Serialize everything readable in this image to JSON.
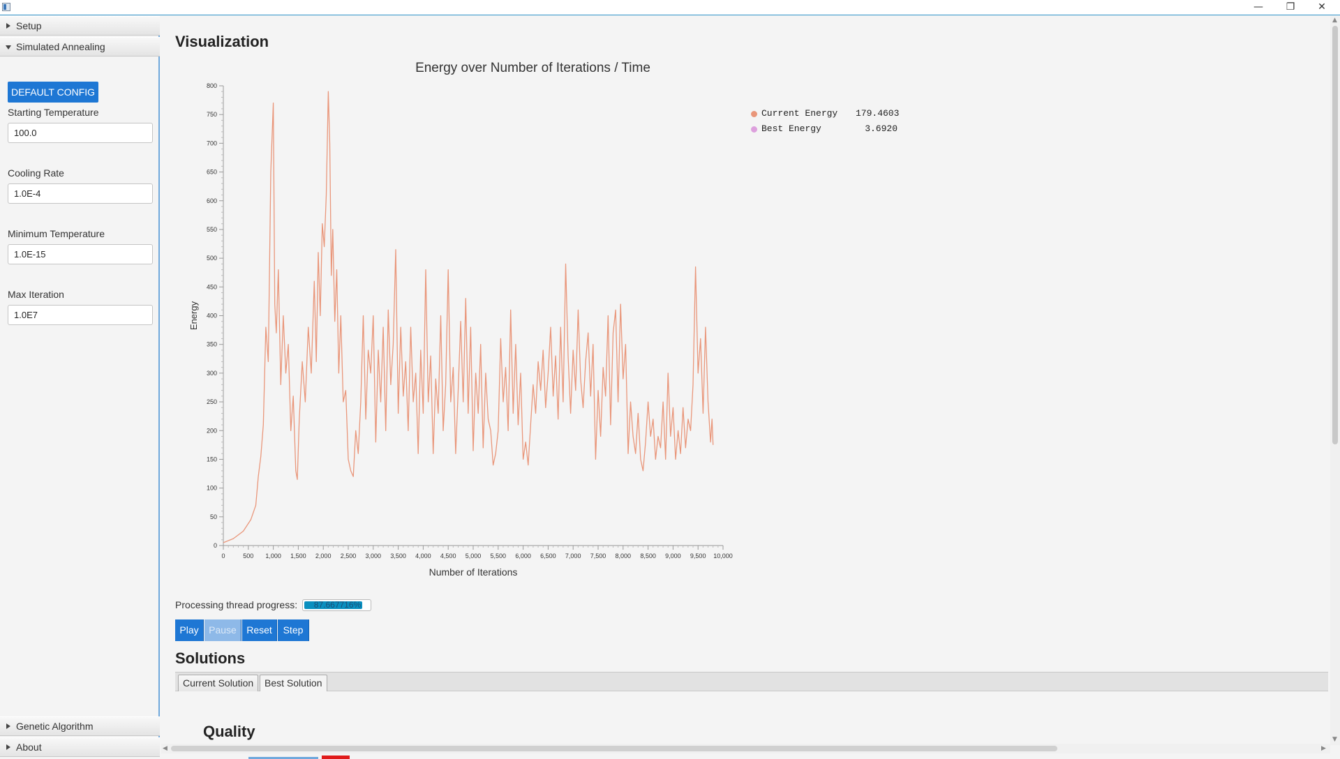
{
  "window": {
    "minimize_glyph": "—",
    "maximize_glyph": "❐",
    "close_glyph": "✕"
  },
  "sidebar": {
    "sections": [
      {
        "label": "Setup",
        "expanded": false
      },
      {
        "label": "Simulated Annealing",
        "expanded": true
      },
      {
        "label": "Genetic Algorithm",
        "expanded": false
      },
      {
        "label": "About",
        "expanded": false
      }
    ],
    "default_config_label": "DEFAULT CONFIG",
    "fields": [
      {
        "label": "Starting Temperature",
        "value": "100.0"
      },
      {
        "label": "Cooling Rate",
        "value": "1.0E-4"
      },
      {
        "label": "Minimum Temperature",
        "value": "1.0E-15"
      },
      {
        "label": "Max Iteration",
        "value": "1.0E7"
      }
    ]
  },
  "main": {
    "visualization_heading": "Visualization",
    "progress_label": "Processing thread progress:",
    "progress_text": "87.667716%",
    "progress_value": 0.87667716,
    "buttons": [
      {
        "label": "Play",
        "enabled": true
      },
      {
        "label": "Pause",
        "enabled": false
      },
      {
        "label": "Reset",
        "enabled": true
      },
      {
        "label": "Step",
        "enabled": true
      }
    ],
    "solutions_heading": "Solutions",
    "tabs": [
      {
        "label": "Current Solution",
        "active": false
      },
      {
        "label": "Best Solution",
        "active": true
      }
    ],
    "quality_heading": "Quality"
  },
  "colors": {
    "accent": "#1e77d4",
    "current_energy": "#e9967a",
    "best_energy": "#dda0dd",
    "progress": "#0a8fbf"
  },
  "chart_data": {
    "type": "line",
    "title": "Energy over Number of Iterations / Time",
    "xlabel": "Number of Iterations",
    "ylabel": "Energy",
    "xlim": [
      0,
      10000
    ],
    "ylim": [
      0,
      800
    ],
    "x_ticks": [
      "0",
      "500",
      "1,000",
      "1,500",
      "2,000",
      "2,500",
      "3,000",
      "3,500",
      "4,000",
      "4,500",
      "5,000",
      "5,500",
      "6,000",
      "6,500",
      "7,000",
      "7,500",
      "8,000",
      "8,500",
      "9,000",
      "9,500",
      "10,000"
    ],
    "y_ticks": [
      "0",
      "50",
      "100",
      "150",
      "200",
      "250",
      "300",
      "350",
      "400",
      "450",
      "500",
      "550",
      "600",
      "650",
      "700",
      "750",
      "800"
    ],
    "legend_position": "top-right",
    "grid": false,
    "legend": [
      {
        "name": "Current Energy",
        "value": "179.4603",
        "color": "#e9967a"
      },
      {
        "name": "Best Energy",
        "value": "3.6920",
        "color": "#dda0dd"
      }
    ],
    "series": [
      {
        "name": "Current Energy",
        "color": "#e9967a",
        "points": [
          [
            0,
            5
          ],
          [
            200,
            12
          ],
          [
            400,
            25
          ],
          [
            550,
            45
          ],
          [
            650,
            70
          ],
          [
            700,
            120
          ],
          [
            750,
            155
          ],
          [
            800,
            210
          ],
          [
            850,
            380
          ],
          [
            900,
            320
          ],
          [
            950,
            650
          ],
          [
            1000,
            770
          ],
          [
            1030,
            420
          ],
          [
            1060,
            370
          ],
          [
            1100,
            480
          ],
          [
            1150,
            280
          ],
          [
            1200,
            400
          ],
          [
            1250,
            300
          ],
          [
            1300,
            350
          ],
          [
            1350,
            200
          ],
          [
            1400,
            260
          ],
          [
            1450,
            130
          ],
          [
            1480,
            115
          ],
          [
            1520,
            220
          ],
          [
            1580,
            320
          ],
          [
            1640,
            250
          ],
          [
            1700,
            380
          ],
          [
            1760,
            300
          ],
          [
            1820,
            460
          ],
          [
            1860,
            320
          ],
          [
            1900,
            510
          ],
          [
            1940,
            400
          ],
          [
            1980,
            560
          ],
          [
            2020,
            520
          ],
          [
            2060,
            610
          ],
          [
            2100,
            790
          ],
          [
            2130,
            700
          ],
          [
            2160,
            470
          ],
          [
            2190,
            550
          ],
          [
            2230,
            390
          ],
          [
            2270,
            480
          ],
          [
            2310,
            300
          ],
          [
            2350,
            400
          ],
          [
            2400,
            250
          ],
          [
            2450,
            270
          ],
          [
            2500,
            150
          ],
          [
            2550,
            130
          ],
          [
            2600,
            120
          ],
          [
            2650,
            200
          ],
          [
            2700,
            160
          ],
          [
            2750,
            250
          ],
          [
            2800,
            400
          ],
          [
            2850,
            220
          ],
          [
            2900,
            340
          ],
          [
            2950,
            300
          ],
          [
            3000,
            400
          ],
          [
            3050,
            180
          ],
          [
            3100,
            340
          ],
          [
            3150,
            250
          ],
          [
            3200,
            380
          ],
          [
            3250,
            200
          ],
          [
            3300,
            410
          ],
          [
            3350,
            280
          ],
          [
            3400,
            350
          ],
          [
            3450,
            515
          ],
          [
            3500,
            230
          ],
          [
            3550,
            380
          ],
          [
            3600,
            260
          ],
          [
            3650,
            320
          ],
          [
            3700,
            200
          ],
          [
            3750,
            380
          ],
          [
            3800,
            250
          ],
          [
            3850,
            300
          ],
          [
            3900,
            160
          ],
          [
            3950,
            340
          ],
          [
            4000,
            230
          ],
          [
            4050,
            480
          ],
          [
            4100,
            250
          ],
          [
            4150,
            330
          ],
          [
            4200,
            160
          ],
          [
            4250,
            290
          ],
          [
            4300,
            230
          ],
          [
            4350,
            400
          ],
          [
            4400,
            200
          ],
          [
            4450,
            280
          ],
          [
            4500,
            480
          ],
          [
            4550,
            250
          ],
          [
            4600,
            310
          ],
          [
            4650,
            160
          ],
          [
            4700,
            270
          ],
          [
            4750,
            390
          ],
          [
            4800,
            250
          ],
          [
            4850,
            430
          ],
          [
            4900,
            230
          ],
          [
            4950,
            380
          ],
          [
            5000,
            165
          ],
          [
            5050,
            300
          ],
          [
            5100,
            230
          ],
          [
            5150,
            350
          ],
          [
            5200,
            170
          ],
          [
            5250,
            300
          ],
          [
            5300,
            220
          ],
          [
            5350,
            200
          ],
          [
            5400,
            140
          ],
          [
            5450,
            160
          ],
          [
            5500,
            200
          ],
          [
            5550,
            360
          ],
          [
            5600,
            250
          ],
          [
            5650,
            310
          ],
          [
            5700,
            200
          ],
          [
            5750,
            410
          ],
          [
            5800,
            230
          ],
          [
            5850,
            350
          ],
          [
            5900,
            210
          ],
          [
            5950,
            300
          ],
          [
            6000,
            150
          ],
          [
            6050,
            180
          ],
          [
            6100,
            140
          ],
          [
            6150,
            210
          ],
          [
            6200,
            280
          ],
          [
            6250,
            230
          ],
          [
            6300,
            320
          ],
          [
            6350,
            270
          ],
          [
            6400,
            340
          ],
          [
            6450,
            240
          ],
          [
            6500,
            300
          ],
          [
            6550,
            380
          ],
          [
            6600,
            260
          ],
          [
            6650,
            330
          ],
          [
            6700,
            220
          ],
          [
            6750,
            380
          ],
          [
            6800,
            250
          ],
          [
            6850,
            490
          ],
          [
            6900,
            330
          ],
          [
            6950,
            230
          ],
          [
            7000,
            340
          ],
          [
            7050,
            270
          ],
          [
            7100,
            410
          ],
          [
            7150,
            290
          ],
          [
            7200,
            240
          ],
          [
            7250,
            320
          ],
          [
            7300,
            370
          ],
          [
            7350,
            260
          ],
          [
            7400,
            350
          ],
          [
            7450,
            150
          ],
          [
            7500,
            270
          ],
          [
            7550,
            190
          ],
          [
            7600,
            310
          ],
          [
            7650,
            260
          ],
          [
            7700,
            400
          ],
          [
            7750,
            210
          ],
          [
            7800,
            370
          ],
          [
            7850,
            410
          ],
          [
            7900,
            250
          ],
          [
            7950,
            420
          ],
          [
            8000,
            290
          ],
          [
            8050,
            350
          ],
          [
            8100,
            160
          ],
          [
            8150,
            250
          ],
          [
            8200,
            190
          ],
          [
            8250,
            160
          ],
          [
            8300,
            230
          ],
          [
            8350,
            150
          ],
          [
            8400,
            130
          ],
          [
            8450,
            180
          ],
          [
            8500,
            250
          ],
          [
            8550,
            190
          ],
          [
            8600,
            220
          ],
          [
            8650,
            150
          ],
          [
            8700,
            190
          ],
          [
            8750,
            170
          ],
          [
            8800,
            250
          ],
          [
            8850,
            150
          ],
          [
            8900,
            300
          ],
          [
            8950,
            190
          ],
          [
            9000,
            240
          ],
          [
            9050,
            150
          ],
          [
            9100,
            200
          ],
          [
            9150,
            160
          ],
          [
            9200,
            240
          ],
          [
            9250,
            170
          ],
          [
            9300,
            220
          ],
          [
            9350,
            200
          ],
          [
            9400,
            280
          ],
          [
            9450,
            485
          ],
          [
            9500,
            300
          ],
          [
            9550,
            360
          ],
          [
            9600,
            230
          ],
          [
            9650,
            380
          ],
          [
            9700,
            250
          ],
          [
            9750,
            180
          ],
          [
            9780,
            220
          ],
          [
            9800,
            175
          ]
        ]
      }
    ]
  }
}
